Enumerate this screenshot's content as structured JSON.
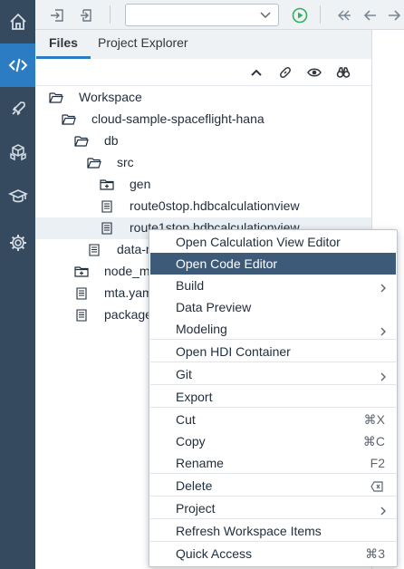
{
  "tabs": [
    {
      "label": "Files",
      "active": true
    },
    {
      "label": "Project Explorer",
      "active": false
    }
  ],
  "toolbar": {
    "run_config_value": ""
  },
  "tree": [
    {
      "label": "Workspace",
      "icon": "folder-open-icon",
      "indent": 0
    },
    {
      "label": "cloud-sample-spaceflight-hana",
      "icon": "folder-open-icon",
      "indent": 1
    },
    {
      "label": "db",
      "icon": "folder-open-icon",
      "indent": 2
    },
    {
      "label": "src",
      "icon": "folder-open-icon",
      "indent": 3
    },
    {
      "label": "gen",
      "icon": "folder-plus-icon",
      "indent": 4
    },
    {
      "label": "route0stop.hdbcalculationview",
      "icon": "file-icon",
      "indent": 4
    },
    {
      "label": "route1stop.hdbcalculationview",
      "icon": "file-icon",
      "indent": 4
    },
    {
      "label": "data-m",
      "icon": "file-icon",
      "indent": 3
    },
    {
      "label": "node_m",
      "icon": "folder-plus-icon",
      "indent": 2
    },
    {
      "label": "mta.yam",
      "icon": "file-icon",
      "indent": 2
    },
    {
      "label": "package",
      "icon": "file-icon",
      "indent": 2
    }
  ],
  "context_menu": {
    "items": [
      {
        "label": "Open Calculation View Editor",
        "shortcut": "",
        "submenu": false
      },
      {
        "label": "Open Code Editor",
        "shortcut": "",
        "submenu": false,
        "selected": true
      },
      {
        "label": "Build",
        "shortcut": "",
        "submenu": true
      },
      {
        "label": "Data Preview",
        "shortcut": "",
        "submenu": false
      },
      {
        "label": "Modeling",
        "shortcut": "",
        "submenu": true
      },
      {
        "label": "Open HDI Container",
        "shortcut": "",
        "submenu": false
      },
      {
        "label": "Git",
        "shortcut": "",
        "submenu": true
      },
      {
        "label": "Export",
        "shortcut": "",
        "submenu": false
      },
      {
        "label": "Cut",
        "shortcut": "⌘X",
        "submenu": false
      },
      {
        "label": "Copy",
        "shortcut": "⌘C",
        "submenu": false
      },
      {
        "label": "Rename",
        "shortcut": "F2",
        "submenu": false
      },
      {
        "label": "Delete",
        "shortcut": "",
        "submenu": false,
        "delete_icon": true
      },
      {
        "label": "Project",
        "shortcut": "",
        "submenu": true
      },
      {
        "label": "Refresh Workspace Items",
        "shortcut": "",
        "submenu": false
      },
      {
        "label": "Quick Access",
        "shortcut": "⌘3",
        "submenu": false
      }
    ]
  },
  "colors": {
    "activity_bar": "#354a5f",
    "activity_active": "#2b7cc3",
    "menu_selected": "#3d5a78",
    "run_green": "#30b05e"
  }
}
